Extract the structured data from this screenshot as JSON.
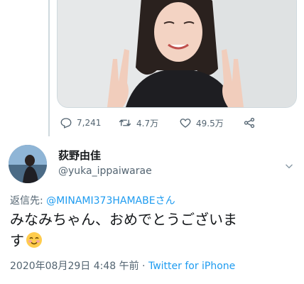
{
  "quoted_tweet": {
    "stats": {
      "replies": "7,241",
      "retweets": "4.7万",
      "likes": "49.5万"
    }
  },
  "tweet": {
    "author_name": "荻野由佳",
    "author_handle": "@yuka_ippaiwarae",
    "reply_prefix": "返信先: ",
    "reply_mention": "@MINAMI373HAMABEさん",
    "text_line1": "みなみちゃん、おめでとうございま",
    "text_line2": "す",
    "timestamp": "2020年08月29日 4:48 午前",
    "separator": " · ",
    "source": "Twitter for iPhone"
  },
  "colors": {
    "link": "#1d9bf0",
    "muted": "#536471",
    "text": "#14171a"
  },
  "icons": [
    "reply-icon",
    "retweet-icon",
    "like-icon",
    "share-icon",
    "chevron-down-icon",
    "smiling-face-emoji"
  ]
}
